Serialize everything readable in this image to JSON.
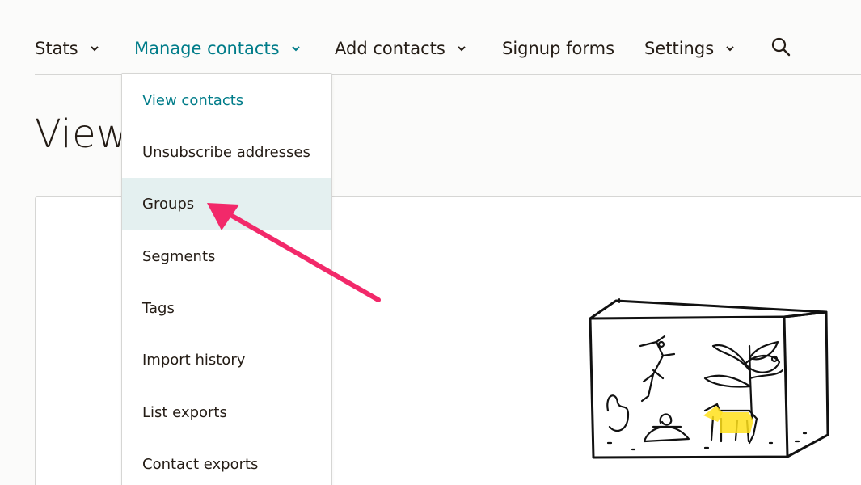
{
  "nav": {
    "items": [
      {
        "label": "Stats",
        "has_caret": true
      },
      {
        "label": "Manage contacts",
        "has_caret": true,
        "active": true
      },
      {
        "label": "Add contacts",
        "has_caret": true
      },
      {
        "label": "Signup forms",
        "has_caret": false
      },
      {
        "label": "Settings",
        "has_caret": true
      }
    ],
    "search_icon": "search-icon"
  },
  "page": {
    "title": "View contacts"
  },
  "dropdown": {
    "items": [
      {
        "label": "View contacts",
        "state": "current"
      },
      {
        "label": "Unsubscribe addresses"
      },
      {
        "label": "Groups",
        "state": "hover"
      },
      {
        "label": "Segments"
      },
      {
        "label": "Tags"
      },
      {
        "label": "Import history"
      },
      {
        "label": "List exports"
      },
      {
        "label": "Contact exports"
      }
    ]
  },
  "colors": {
    "accent": "#007c89",
    "hover_bg": "#e4f0f0",
    "annotation_arrow": "#f2296a",
    "illustration_highlight": "#ffe01b"
  }
}
